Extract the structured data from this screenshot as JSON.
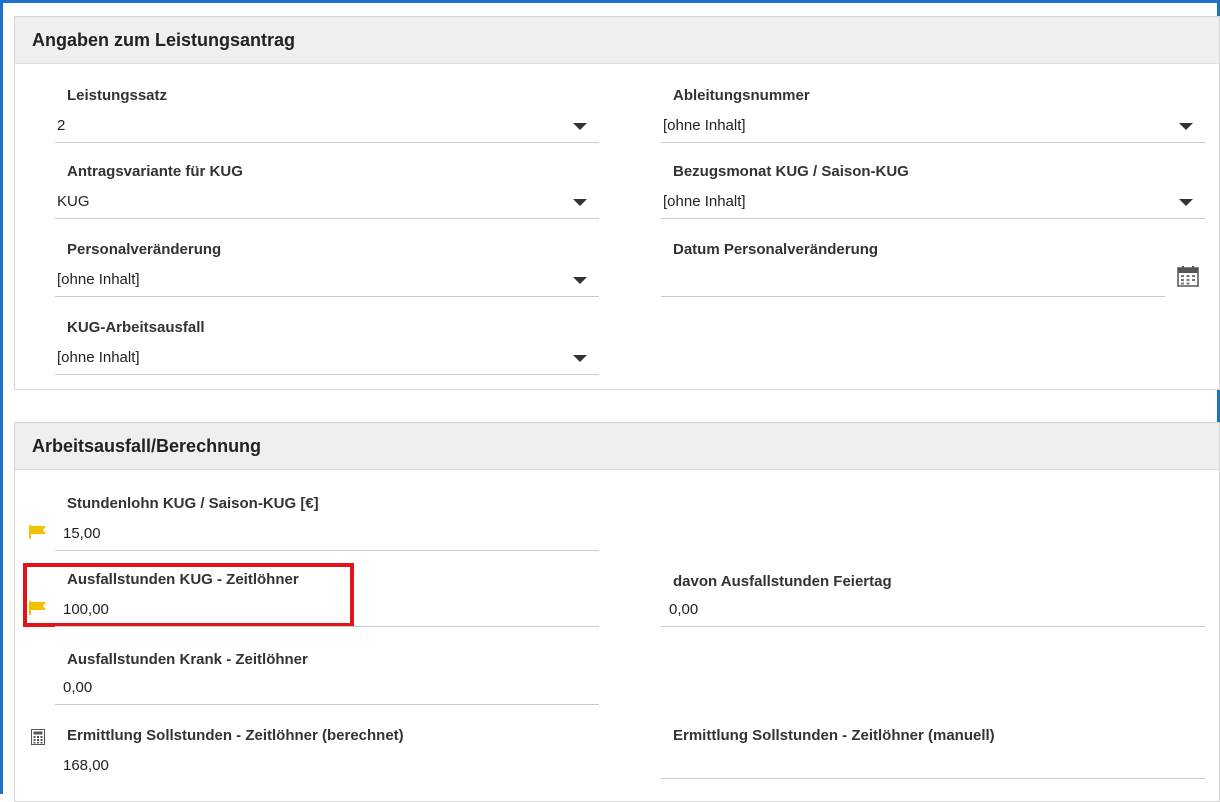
{
  "section1": {
    "title": "Angaben zum Leistungsantrag",
    "fields": {
      "leistungssatz": {
        "label": "Leistungssatz",
        "value": "2"
      },
      "ableitungsnummer": {
        "label": "Ableitungsnummer",
        "value": "[ohne Inhalt]"
      },
      "antragsvariante": {
        "label": "Antragsvariante für KUG",
        "value": "KUG"
      },
      "bezugsmonat": {
        "label": "Bezugsmonat KUG / Saison-KUG",
        "value": "[ohne Inhalt]"
      },
      "personalveraenderung": {
        "label": "Personalveränderung",
        "value": "[ohne Inhalt]"
      },
      "datum_personalveraenderung": {
        "label": "Datum Personalveränderung",
        "value": ""
      },
      "kug_arbeitsausfall": {
        "label": "KUG-Arbeitsausfall",
        "value": "[ohne Inhalt]"
      }
    }
  },
  "section2": {
    "title": "Arbeitsausfall/Berechnung",
    "fields": {
      "stundenlohn": {
        "label": "Stundenlohn KUG / Saison-KUG [€]",
        "value": "15,00"
      },
      "ausfallstunden_kug": {
        "label": "Ausfallstunden KUG - Zeitlöhner",
        "value": "100,00"
      },
      "ausfallstunden_feiertag": {
        "label": "davon Ausfallstunden Feiertag",
        "value": "0,00"
      },
      "ausfallstunden_krank": {
        "label": "Ausfallstunden Krank - Zeitlöhner",
        "value": "0,00"
      },
      "sollstunden_berechnet": {
        "label": "Ermittlung Sollstunden - Zeitlöhner (berechnet)",
        "value": "168,00"
      },
      "sollstunden_manuell": {
        "label": "Ermittlung Sollstunden - Zeitlöhner (manuell)",
        "value": ""
      }
    }
  },
  "icons": {
    "flag": "flag-icon",
    "calendar": "calendar-icon",
    "calculator": "calculator-icon",
    "dropdown": "chevron-down-icon"
  },
  "colors": {
    "frame_border": "#1a73c9",
    "highlight": "#e3131b",
    "flag": "#f2c100",
    "header_bg": "#efefef"
  }
}
